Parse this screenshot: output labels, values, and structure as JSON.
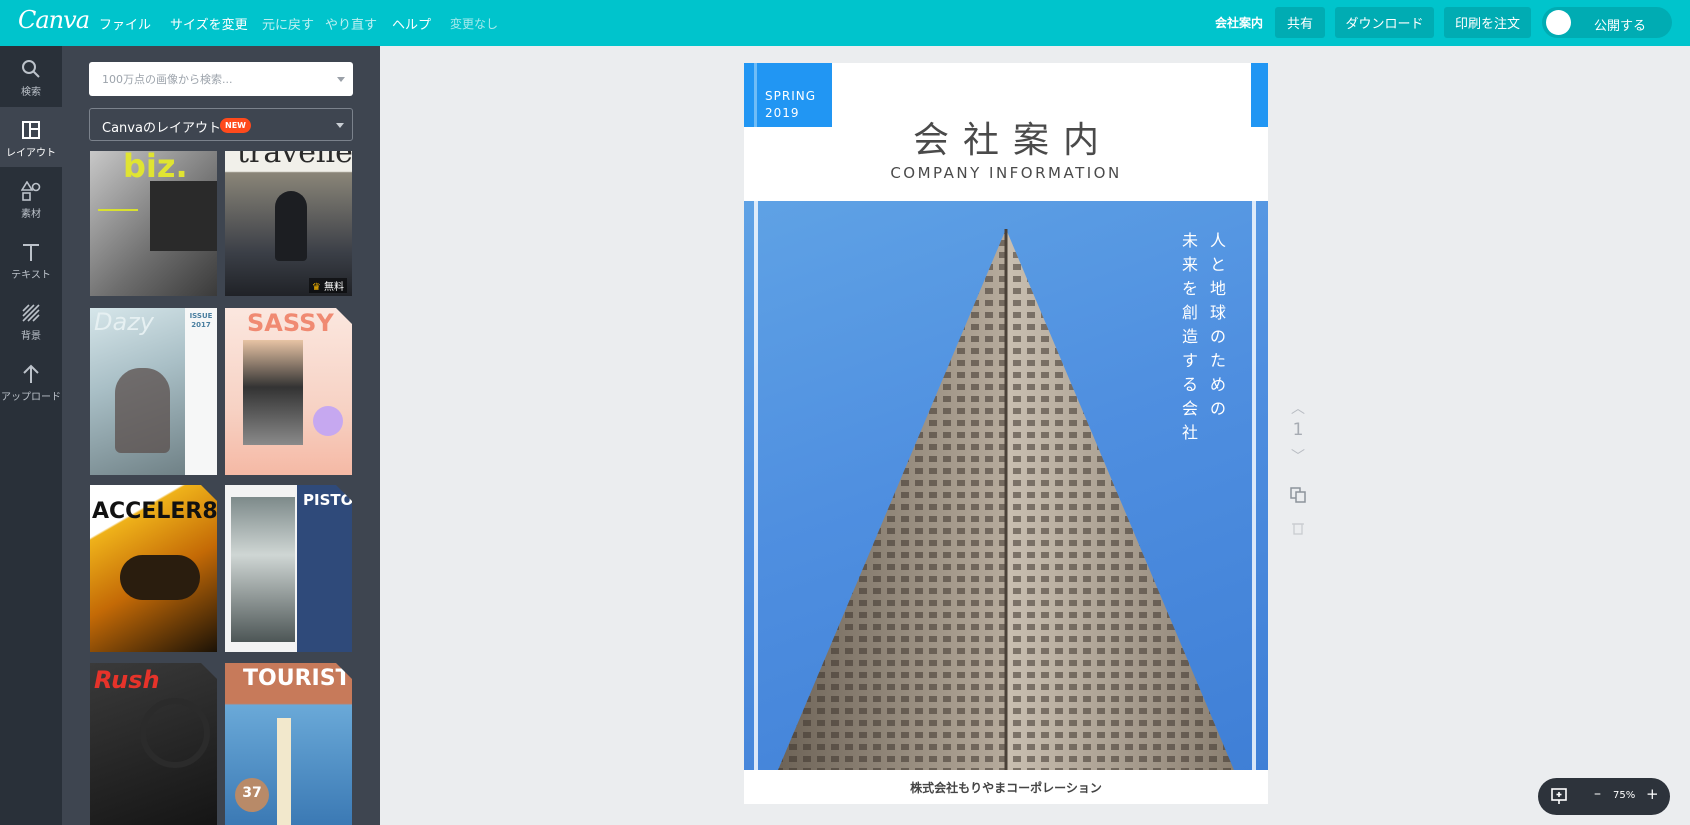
{
  "app": {
    "logo": "Canva"
  },
  "topbar": {
    "menu": [
      "ファイル",
      "サイズを変更",
      "元に戻す",
      "やり直す",
      "ヘルプ",
      "変更なし"
    ],
    "doc_title": "会社案内",
    "share": "共有",
    "download": "ダウンロード",
    "order_print": "印刷を注文",
    "publish": "公開する"
  },
  "rail": {
    "items": [
      {
        "label": "検索",
        "icon": "search-icon"
      },
      {
        "label": "レイアウト",
        "icon": "layout-icon"
      },
      {
        "label": "素材",
        "icon": "elements-icon"
      },
      {
        "label": "テキスト",
        "icon": "text-icon"
      },
      {
        "label": "背景",
        "icon": "background-icon"
      },
      {
        "label": "アップロード",
        "icon": "upload-icon"
      }
    ],
    "active": "レイアウト"
  },
  "panel": {
    "search_placeholder": "100万点の画像から検索...",
    "layout_select": "Canvaのレイアウト",
    "new_badge": "NEW",
    "thumbnails": [
      {
        "title": "biz."
      },
      {
        "title": "travelle",
        "badge": "無料"
      },
      {
        "title": "Dazy",
        "side": "ISSUE 2017"
      },
      {
        "title": "SASSY"
      },
      {
        "title": "ACCELER8"
      },
      {
        "title": "PISTON"
      },
      {
        "title": "Rush"
      },
      {
        "title": "TOURIST",
        "badge": "37"
      }
    ]
  },
  "design": {
    "spring": "SPRING\n2019",
    "title_jp": "会社案内",
    "title_en": "COMPANY INFORMATION",
    "vertical_col1": "人と地球のための",
    "vertical_col2": "未来を創造する会社",
    "footer": "株式会社もりやまコーポレーション"
  },
  "page_nav": {
    "page_number": "1"
  },
  "zoom": {
    "value": "75%",
    "minus": "–",
    "plus": "+"
  },
  "colors": {
    "brand": "#00c4cc",
    "accent_blue": "#2196f3",
    "badge": "#ff4a1c"
  }
}
